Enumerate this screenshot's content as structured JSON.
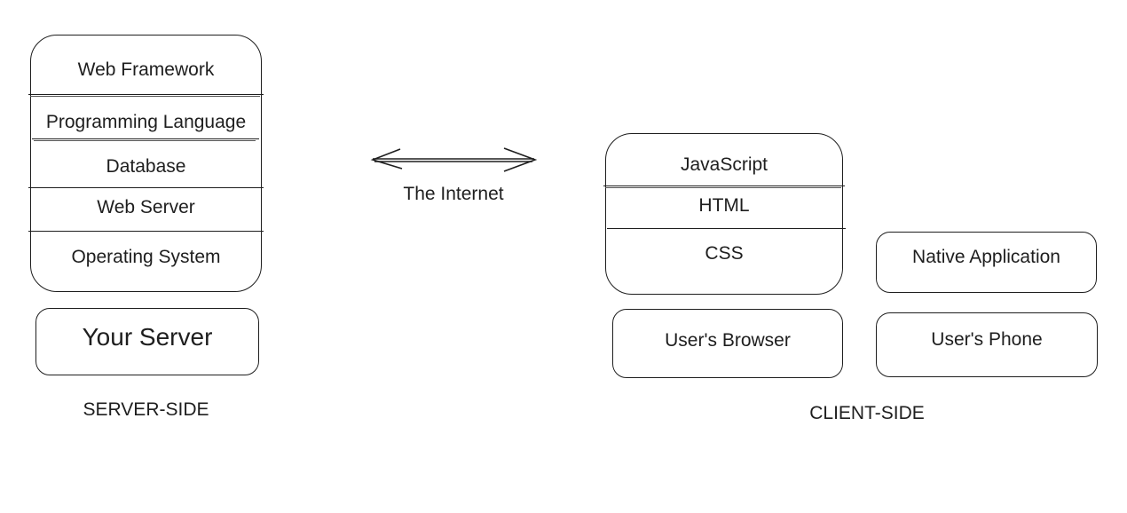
{
  "server_side": {
    "stack": [
      "Web Framework",
      "Programming Language",
      "Database",
      "Web Server",
      "Operating System"
    ],
    "base": "Your Server",
    "caption": "SERVER-SIDE"
  },
  "connector": {
    "label": "The Internet",
    "direction": "bidirectional"
  },
  "client_side": {
    "browser_stack": [
      "JavaScript",
      "HTML",
      "CSS"
    ],
    "browser_base": "User's Browser",
    "phone_stack": [
      "Native Application"
    ],
    "phone_base": "User's Phone",
    "caption": "CLIENT-SIDE"
  }
}
